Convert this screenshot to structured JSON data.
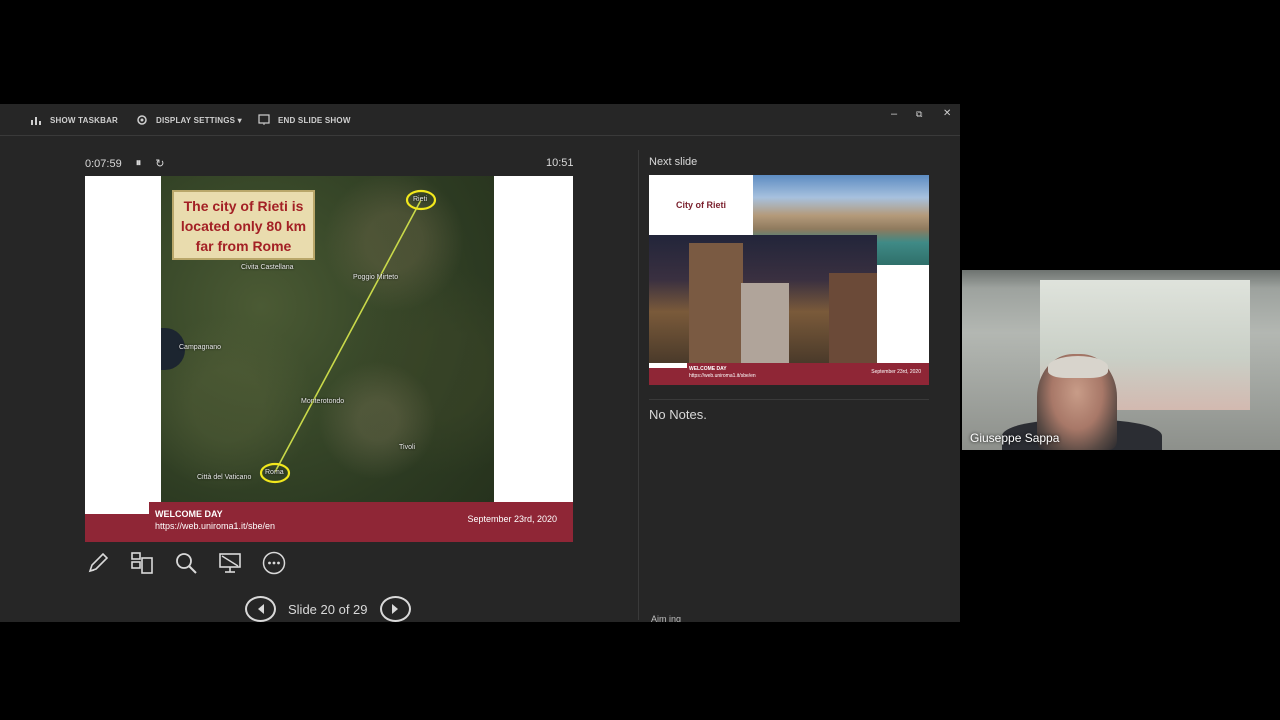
{
  "toolbar": {
    "show_taskbar": "SHOW TASKBAR",
    "display_settings": "DISPLAY SETTINGS ▾",
    "end_slide_show": "END SLIDE SHOW",
    "minimize": "–",
    "restore": "⧉",
    "close": "✕"
  },
  "presenter": {
    "elapsed_time": "0:07:59",
    "clock": "10:51",
    "slide_counter": "Slide 20 of 29"
  },
  "current_slide": {
    "callout_text": "The city of Rieti is located only 80 km far from Rome",
    "map_labels": [
      "Civita Castellana",
      "Poggio Mirteto",
      "Campagnano",
      "Monterotondo",
      "Città del Vaticano",
      "Rieti",
      "Roma",
      "Tivoli"
    ],
    "footer_title": "WELCOME DAY",
    "footer_url": "https://web.uniroma1.it/sbe/en",
    "footer_date": "September 23rd, 2020"
  },
  "next_slide": {
    "label": "Next slide",
    "title": "City of Rieti",
    "footer_title": "WELCOME DAY",
    "footer_url": "https://web.uniroma1.it/sbe/en",
    "footer_date": "September 23rd, 2020"
  },
  "notes": {
    "text": "No Notes.",
    "cut_heading": "Aim ing"
  },
  "video": {
    "participant_name": "Giuseppe Sappa"
  },
  "tools": [
    "pen-icon",
    "slides-grid-icon",
    "zoom-icon",
    "screen-icon",
    "more-icon"
  ]
}
